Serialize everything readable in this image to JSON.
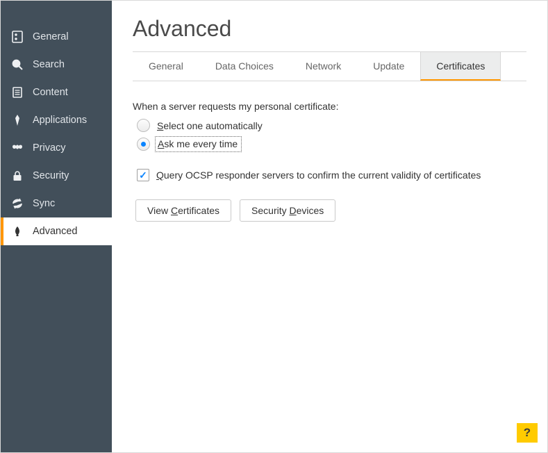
{
  "sidebar": {
    "items": [
      {
        "label": "General"
      },
      {
        "label": "Search"
      },
      {
        "label": "Content"
      },
      {
        "label": "Applications"
      },
      {
        "label": "Privacy"
      },
      {
        "label": "Security"
      },
      {
        "label": "Sync"
      },
      {
        "label": "Advanced"
      }
    ],
    "activeIndex": 7
  },
  "page": {
    "title": "Advanced"
  },
  "tabs": {
    "items": [
      {
        "label": "General"
      },
      {
        "label": "Data Choices"
      },
      {
        "label": "Network"
      },
      {
        "label": "Update"
      },
      {
        "label": "Certificates"
      }
    ],
    "activeIndex": 4
  },
  "certificates": {
    "requestLabel": "When a server requests my personal certificate:",
    "options": {
      "auto": {
        "prefix": "S",
        "rest": "elect one automatically",
        "checked": false
      },
      "ask": {
        "prefix": "A",
        "rest": "sk me every time",
        "checked": true
      }
    },
    "ocsp": {
      "prefix": "Q",
      "rest": "uery OCSP responder servers to confirm the current validity of certificates",
      "checked": true
    },
    "buttons": {
      "viewCerts": {
        "pre": "View ",
        "ul": "C",
        "post": "ertificates"
      },
      "secDevices": {
        "pre": "Security ",
        "ul": "D",
        "post": "evices"
      }
    }
  },
  "help": {
    "label": "?"
  }
}
